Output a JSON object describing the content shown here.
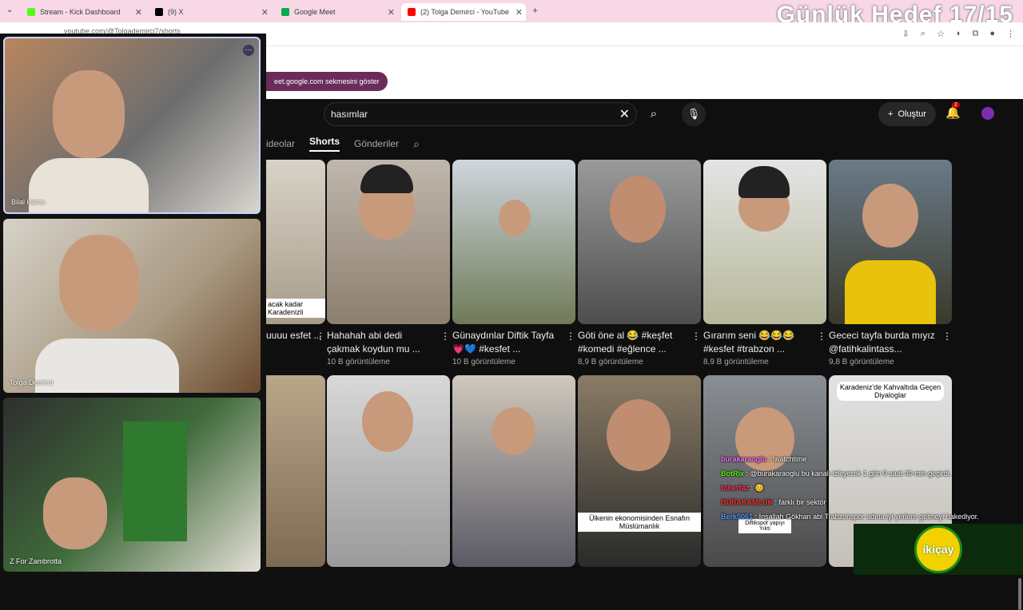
{
  "browser": {
    "tabs": [
      {
        "label": "Stream - Kick Dashboard",
        "color": "#53fc18"
      },
      {
        "label": "(9) X",
        "color": "#000000"
      },
      {
        "label": "Google Meet",
        "color": "#00ac47"
      },
      {
        "label": "(2) Tolga Demirci - YouTube",
        "color": "#ff0000"
      }
    ],
    "url": "youtube.com/@Tolgademirci7/shorts"
  },
  "overlay": {
    "title": "Günlük Hedef 17/15"
  },
  "meet_pill": "eet.google.com sekmesini göster",
  "youtube": {
    "search_value": "hasımlar",
    "create_label": "Oluştur",
    "notif_count": "2",
    "tabs": [
      "ideolar",
      "Shorts",
      "Gönderiler"
    ],
    "row1": [
      {
        "title": "uuuu esfet ...",
        "views": "",
        "caption": "acak kadar Karadenizli"
      },
      {
        "title": "Hahahah abi dedi çakmak koydun mu ...",
        "views": "10 B görüntüleme"
      },
      {
        "title": "Günaydınlar Diftik Tayfa 💗💙 #kesfet ...",
        "views": "10 B görüntüleme"
      },
      {
        "title": "Göti öne al 😂 #keşfet #komedi #eğlence ...",
        "views": "8,9 B görüntüleme"
      },
      {
        "title": "Gırarım seni 😂😂😂 #kesfet #trabzon ...",
        "views": "8,9 B görüntüleme"
      },
      {
        "title": "Gececi tayfa burda mıyız @fatihkalintass...",
        "views": "9,8 B görüntüleme"
      }
    ],
    "row2_captions": [
      "",
      "",
      "",
      "Ülkenin ekonomisinden Esnafın Müslümanlık",
      "Diftikspor yapıyı Yıktı",
      "Karadeniz'de Kahvaltıda Geçen Diyaloglar"
    ]
  },
  "cams": [
    {
      "name": "Bilal Hancı"
    },
    {
      "name": "Tolga Demirci"
    },
    {
      "name": "Z For Zambrotta"
    }
  ],
  "chat": [
    {
      "user": "burakaraoglu",
      "text": ": !watchtime",
      "color": "#ff77ff"
    },
    {
      "user": "BotRix",
      "text": ": @burakaraoglu bu kanalı izleyerek 1 gün 9 saat 40 min geçirdi.",
      "color": "#53fc18"
    },
    {
      "user": "toberfaz",
      "text": ": 😊",
      "color": "#ff3366"
    },
    {
      "user": "BURAKAMLUK",
      "text": ": farklı bir sektör",
      "color": "#ff3333"
    },
    {
      "user": "Berk0061",
      "text": ": İnşallah Gökhan abi Trabzonspor adına iyi yerlere gelmeyi hakediyor.",
      "color": "#5599ff"
    }
  ],
  "sponsor": {
    "label": "ikiçay"
  }
}
